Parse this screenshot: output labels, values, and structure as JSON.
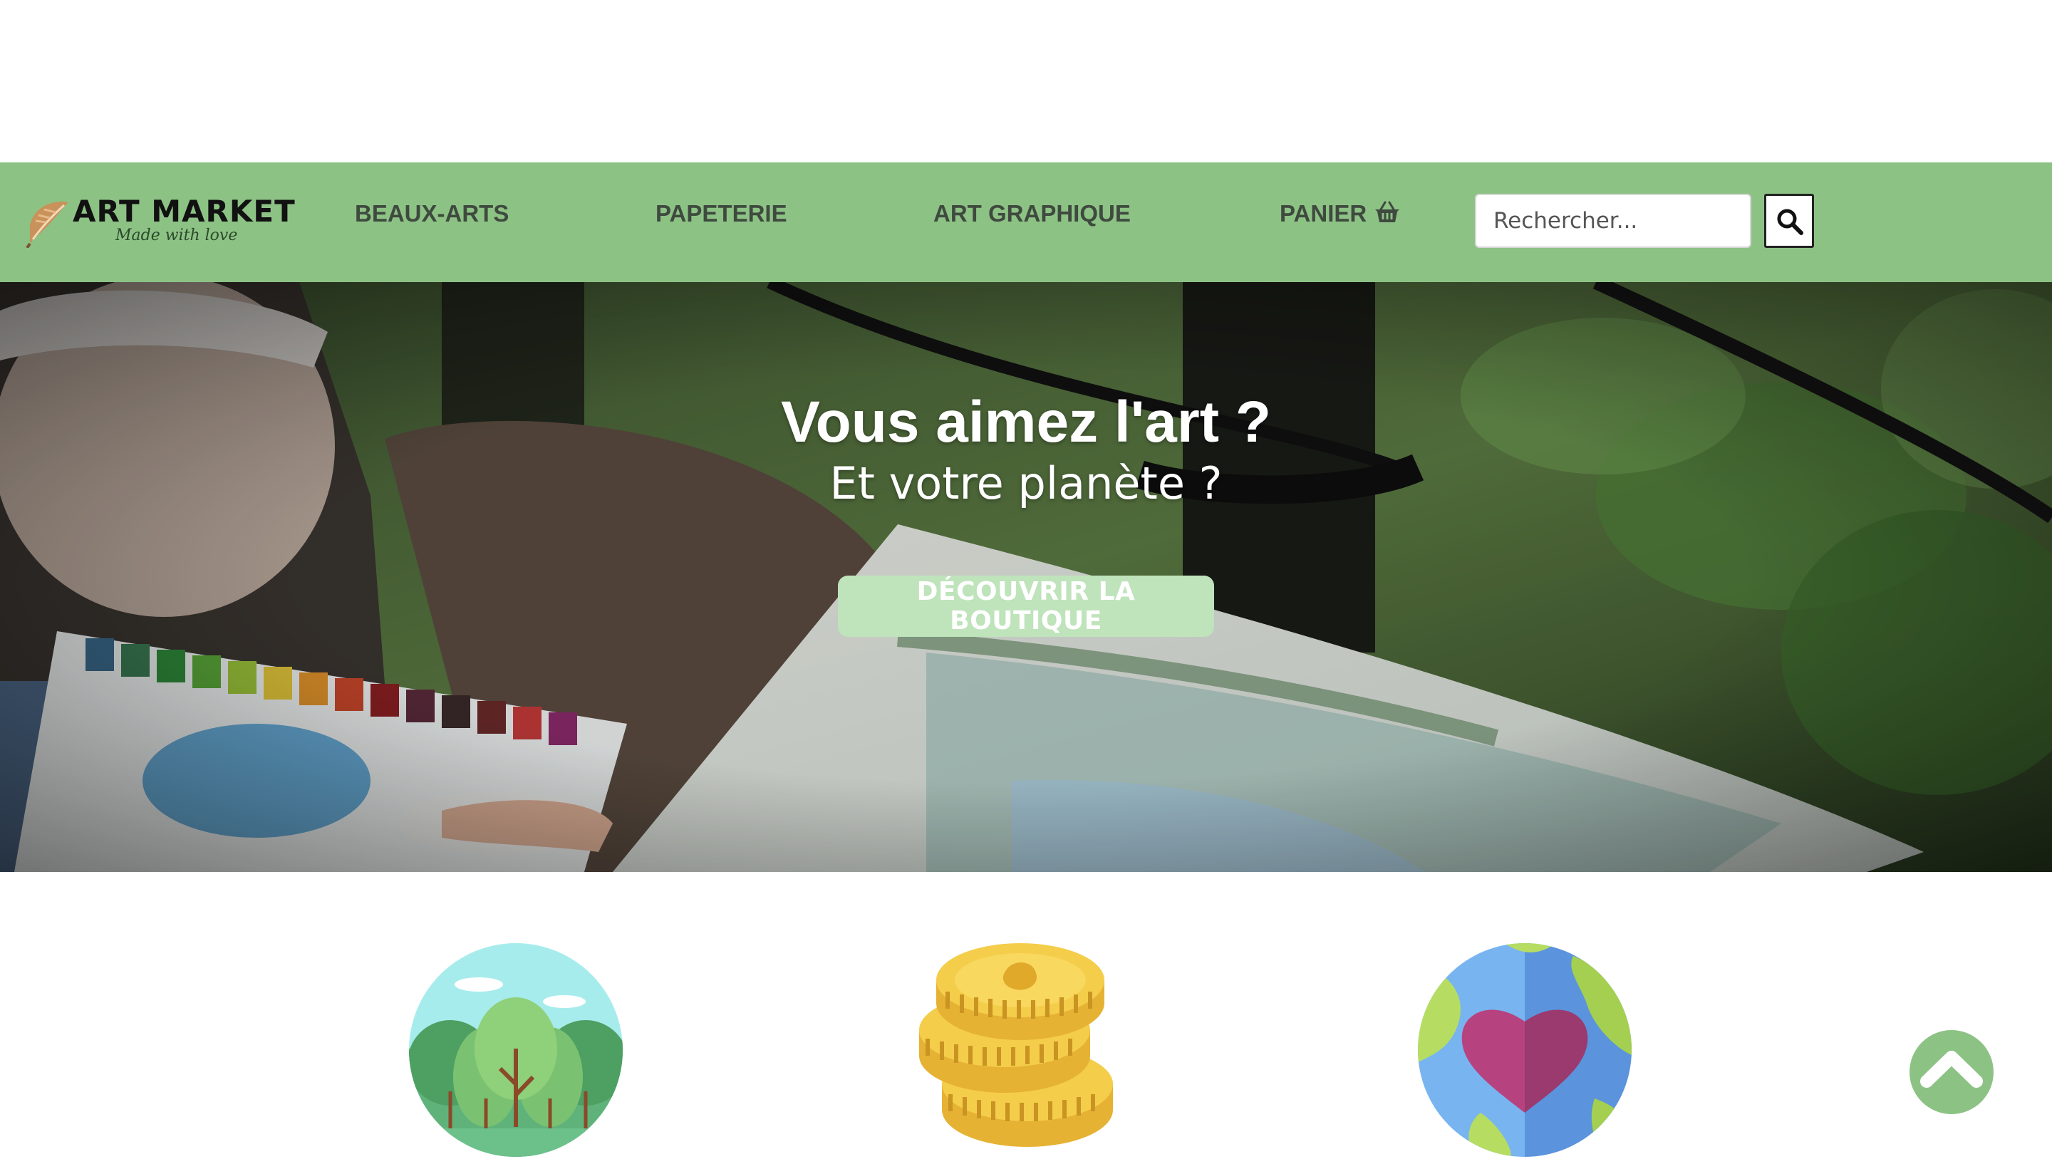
{
  "brand": {
    "name": "ART MARKET",
    "tagline": "Made with love"
  },
  "nav": {
    "items": [
      {
        "label": "BEAUX-ARTS"
      },
      {
        "label": "PAPETERIE"
      },
      {
        "label": "ART GRAPHIQUE"
      },
      {
        "label": "PANIER",
        "icon": "basket-icon"
      }
    ]
  },
  "search": {
    "placeholder": "Rechercher...",
    "value": "",
    "button_icon": "search-icon"
  },
  "hero": {
    "title": "Vous aimez l'art ?",
    "subtitle": "Et votre planète ?",
    "cta_label": "DÉCOUVRIR LA BOUTIQUE"
  },
  "features": [
    {
      "icon": "forest-icon"
    },
    {
      "icon": "coins-icon"
    },
    {
      "icon": "heart-earth-icon"
    }
  ],
  "colors": {
    "nav_background": "#8dc285",
    "cta_background": "#bfe3bb",
    "accent_green": "#8dc285"
  },
  "back_to_top": {
    "icon": "chevron-up-icon"
  }
}
